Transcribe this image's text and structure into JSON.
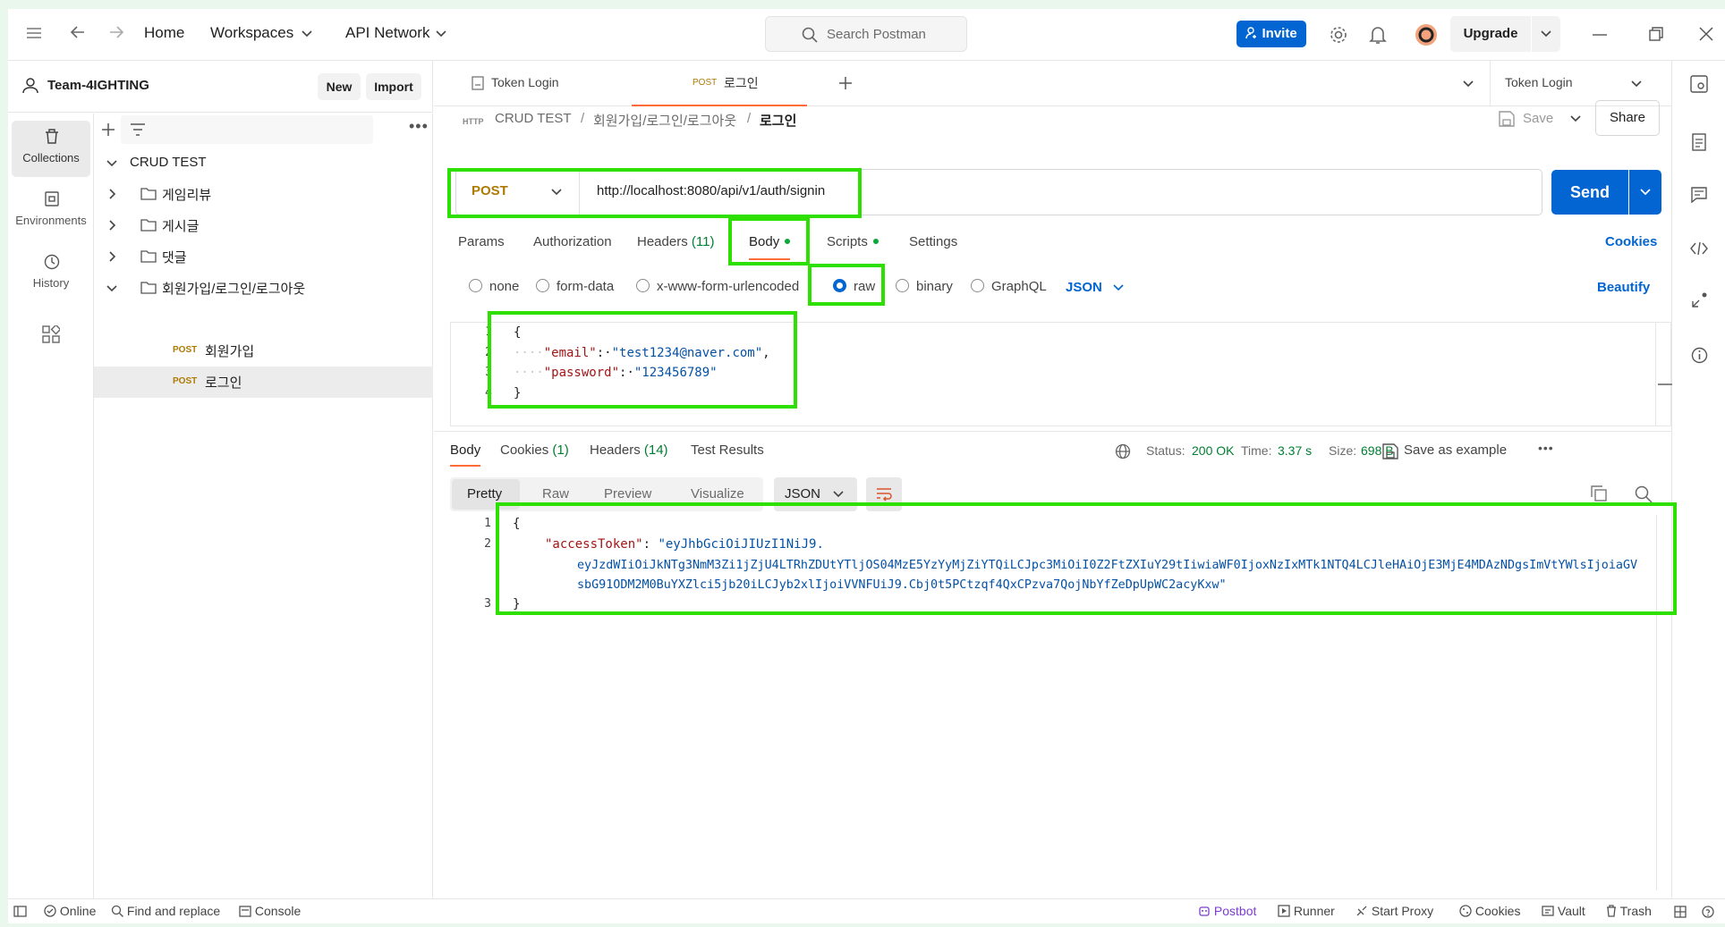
{
  "topbar": {
    "nav": [
      "Home",
      "Workspaces",
      "API Network"
    ],
    "search_placeholder": "Search Postman",
    "invite": "Invite",
    "upgrade": "Upgrade"
  },
  "workspace": {
    "name": "Team-4IGHTING",
    "new": "New",
    "import": "Import"
  },
  "leftnav": [
    {
      "label": "Collections",
      "icon": "trash-icon"
    },
    {
      "label": "Environments",
      "icon": "environment-icon"
    },
    {
      "label": "History",
      "icon": "history-icon"
    }
  ],
  "tree": {
    "collection": "CRUD TEST",
    "folders": [
      "게임리뷰",
      "게시글",
      "댓글",
      "회원가입/로그인/로그아웃"
    ],
    "requests": [
      {
        "method": "POST",
        "name": "회원가입"
      },
      {
        "method": "POST",
        "name": "로그인"
      }
    ]
  },
  "tabs": [
    {
      "label": "Token Login",
      "method": ""
    },
    {
      "label": "로그인",
      "method": "POST"
    }
  ],
  "env_selector": "Token Login",
  "breadcrumb": {
    "root": "CRUD TEST",
    "folder": "회원가입/로그인/로그아웃",
    "current": "로그인",
    "save": "Save",
    "share": "Share"
  },
  "request": {
    "method": "POST",
    "url": "http://localhost:8080/api/v1/auth/signin",
    "send": "Send",
    "tabs": [
      "Params",
      "Authorization",
      "Headers",
      "Body",
      "Scripts",
      "Settings"
    ],
    "headers_count": "(11)",
    "cookies": "Cookies",
    "body_types": [
      "none",
      "form-data",
      "x-www-form-urlencoded",
      "raw",
      "binary",
      "GraphQL"
    ],
    "body_format": "JSON",
    "beautify": "Beautify",
    "body_lines": [
      {
        "n": "1",
        "text": "{"
      },
      {
        "n": "2",
        "indent": "····",
        "key": "\"email\"",
        "sep": ":·",
        "val": "\"test1234@naver.com\"",
        "end": ","
      },
      {
        "n": "3",
        "indent": "····",
        "key": "\"password\"",
        "sep": ":·",
        "val": "\"123456789\"",
        "end": ""
      },
      {
        "n": "4",
        "text": "}"
      }
    ]
  },
  "response": {
    "tabs": [
      "Body",
      "Cookies",
      "Headers",
      "Test Results"
    ],
    "cookies_count": "(1)",
    "headers_count": "(14)",
    "status_label": "Status:",
    "status": "200 OK",
    "time_label": "Time:",
    "time": "3.37 s",
    "size_label": "Size:",
    "size": "698 B",
    "save_example": "Save as example",
    "views": [
      "Pretty",
      "Raw",
      "Preview",
      "Visualize"
    ],
    "format": "JSON",
    "lines": [
      {
        "n": "1",
        "text": "{"
      },
      {
        "n": "2",
        "key": "\"accessToken\"",
        "sep": ": ",
        "val1": "\"eyJhbGciOiJIUzI1NiJ9.",
        "val2": "eyJzdWIiOiJkNTg3NmM3Zi1jZjU4LTRhZDUtYTljOS04MzE5YzYyMjZiYTQiLCJpc3MiOiI0Z2FtZXIuY29tIiwiaWF0IjoxNzIxMTk1NTQ4LCJleHAiOjE3MjE4MDAzNDgsImVtYWlsIjoiaGVsbG91ODM2M0BuYXZlci5jb20iLCJyb2xlIjoiVVNFUiJ9.Cbj0t5PCtzqf4QxCPzva7QojNbYfZeDpUpWC2acyKxw\""
      },
      {
        "n": "3",
        "text": "}"
      }
    ]
  },
  "statusbar": {
    "left": [
      "Online",
      "Find and replace",
      "Console"
    ],
    "right": [
      "Postbot",
      "Runner",
      "Start Proxy",
      "Cookies",
      "Vault",
      "Trash"
    ]
  },
  "colors": {
    "accent": "#0265d2",
    "post": "#ad7a03",
    "green": "#007f31",
    "highlight": "#2ee000"
  }
}
